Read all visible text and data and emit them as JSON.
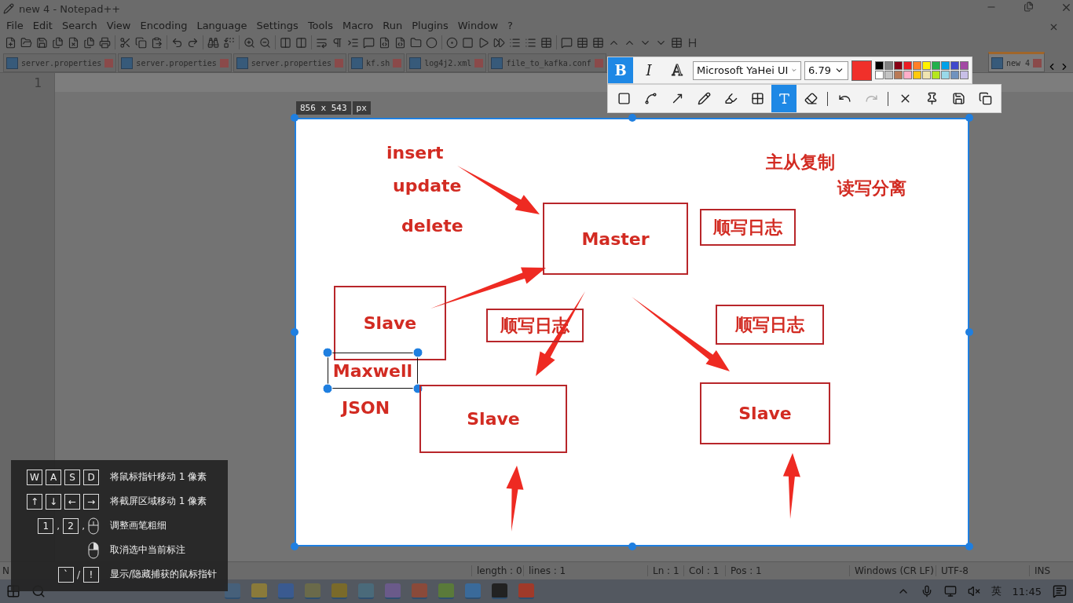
{
  "window": {
    "title": "new 4 - Notepad++"
  },
  "menu": [
    "File",
    "Edit",
    "Search",
    "View",
    "Encoding",
    "Language",
    "Settings",
    "Tools",
    "Macro",
    "Run",
    "Plugins",
    "Window",
    "?"
  ],
  "tabs": [
    {
      "label": "server.properties",
      "selected": false
    },
    {
      "label": "server.properties",
      "selected": false
    },
    {
      "label": "server.properties",
      "selected": false
    },
    {
      "label": "kf.sh",
      "selected": false
    },
    {
      "label": "log4j2.xml",
      "selected": false
    },
    {
      "label": "file_to_kafka.conf",
      "selected": false
    },
    {
      "label": "new 4",
      "selected": true
    }
  ],
  "editor": {
    "line_number": "1"
  },
  "status_bar": {
    "file_type": "N",
    "length": "length : 0",
    "lines": "lines : 1",
    "ln": "Ln : 1",
    "col": "Col : 1",
    "pos": "Pos : 1",
    "eol": "Windows (CR LF)",
    "encoding": "UTF-8",
    "mode": "INS"
  },
  "taskbar": {
    "ime": "英",
    "time": "11:45"
  },
  "capture": {
    "size": "856 x 543",
    "unit": "px"
  },
  "annotation_toolbar": {
    "format_buttons": [
      {
        "text": "B",
        "selected": true
      },
      {
        "text": "I",
        "selected": false
      },
      {
        "text": "A",
        "selected": false
      }
    ],
    "font": "Microsoft YaHei UI",
    "font_size": "6.79",
    "palette": [
      {
        "color": "#000000"
      },
      {
        "color": "#808080"
      },
      {
        "color": "#880015"
      },
      {
        "color": "#ed1c24"
      },
      {
        "color": "#ff7f27"
      },
      {
        "color": "#fff200"
      },
      {
        "color": "#22b14c"
      },
      {
        "color": "#00a2e8"
      },
      {
        "color": "#3f48cc"
      },
      {
        "color": "#a349a4"
      },
      {
        "color": "#ffffff"
      },
      {
        "color": "#c3c3c3"
      },
      {
        "color": "#b97a57"
      },
      {
        "color": "#ffaec9"
      },
      {
        "color": "#ffc90e"
      },
      {
        "color": "#efe4b0"
      },
      {
        "color": "#b5e61d"
      },
      {
        "color": "#99d9ea"
      },
      {
        "color": "#7092be"
      },
      {
        "color": "#c8bfe7"
      }
    ],
    "tools": [
      {
        "kind": "shape",
        "selected": false
      },
      {
        "kind": "polyline",
        "selected": false
      },
      {
        "kind": "arrow",
        "selected": false
      },
      {
        "kind": "pencil",
        "selected": false
      },
      {
        "kind": "marker",
        "selected": false
      },
      {
        "kind": "mosaic",
        "selected": false
      },
      {
        "kind": "text",
        "selected": true
      },
      {
        "kind": "eraser",
        "selected": false
      },
      {
        "kind": "separator"
      },
      {
        "kind": "undo",
        "disabled": false
      },
      {
        "kind": "redo",
        "disabled": true
      },
      {
        "kind": "separator"
      },
      {
        "kind": "cancel"
      },
      {
        "kind": "pin"
      },
      {
        "kind": "save"
      },
      {
        "kind": "copy"
      }
    ]
  },
  "diagram": {
    "items": [
      {
        "kind": "text",
        "text": "insert",
        "selected": false
      },
      {
        "kind": "text",
        "text": "update",
        "selected": false
      },
      {
        "kind": "text",
        "text": "delete",
        "selected": false
      },
      {
        "kind": "text",
        "text": "主从复制",
        "selected": false
      },
      {
        "kind": "text",
        "text": "读写分离",
        "selected": false
      },
      {
        "kind": "box",
        "text": "Master",
        "selected": false
      },
      {
        "kind": "box",
        "text": "顺写日志",
        "selected": false
      },
      {
        "kind": "box",
        "text": "Slave",
        "selected": false
      },
      {
        "kind": "box",
        "text": "顺写日志",
        "selected": false
      },
      {
        "kind": "box",
        "text": "顺写日志",
        "selected": false
      },
      {
        "kind": "text",
        "text": "Maxwell",
        "selected": true
      },
      {
        "kind": "text",
        "text": "JSON",
        "selected": false
      },
      {
        "kind": "box",
        "text": "Slave",
        "selected": false
      },
      {
        "kind": "box",
        "text": "Slave",
        "selected": false
      },
      {
        "kind": "arrow"
      },
      {
        "kind": "arrow"
      },
      {
        "kind": "arrow"
      },
      {
        "kind": "arrow"
      },
      {
        "kind": "arrow"
      },
      {
        "kind": "arrow"
      }
    ]
  },
  "shortcuts": [
    {
      "keys": [
        {
          "kind": "key",
          "text": "W"
        },
        {
          "kind": "key",
          "text": "A"
        },
        {
          "kind": "key",
          "text": "S"
        },
        {
          "kind": "key",
          "text": "D"
        }
      ],
      "description": "将鼠标指针移动 1 像素"
    },
    {
      "keys": [
        {
          "kind": "key",
          "text": "↑"
        },
        {
          "kind": "key",
          "text": "↓"
        },
        {
          "kind": "key",
          "text": "←"
        },
        {
          "kind": "key",
          "text": "→"
        }
      ],
      "description": "将截屏区域移动 1 像素"
    },
    {
      "keys": [
        {
          "kind": "key",
          "text": "1"
        },
        {
          "kind": "sep",
          "text": ","
        },
        {
          "kind": "key",
          "text": "2"
        },
        {
          "kind": "sep",
          "text": ","
        },
        {
          "kind": "mouse-wheel"
        }
      ],
      "description": "调整画笔粗细"
    },
    {
      "keys": [
        {
          "kind": "mouse-right"
        }
      ],
      "description": "取消选中当前标注"
    },
    {
      "keys": [
        {
          "kind": "key",
          "text": "`"
        },
        {
          "kind": "sep",
          "text": "/"
        },
        {
          "kind": "key",
          "text": "!"
        }
      ],
      "description": "显示/隐藏捕获的鼠标指针"
    }
  ]
}
